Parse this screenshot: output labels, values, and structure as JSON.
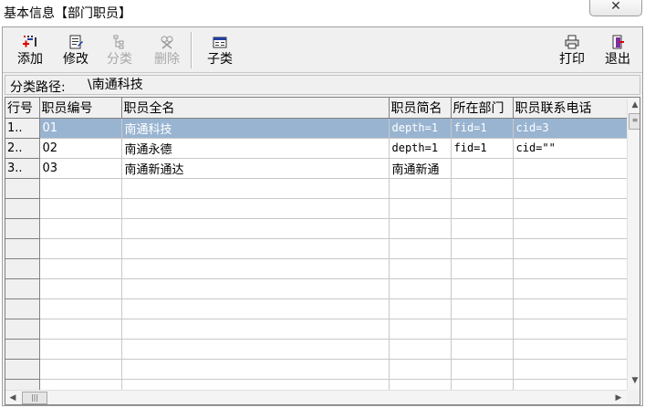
{
  "window": {
    "title": "基本信息【部门职员】",
    "close_glyph": "✕"
  },
  "toolbar": {
    "add": {
      "label": "添加",
      "icon": "add-icon"
    },
    "edit": {
      "label": "修改",
      "icon": "edit-icon"
    },
    "classify": {
      "label": "分类",
      "icon": "classify-icon",
      "disabled": true
    },
    "delete": {
      "label": "删除",
      "icon": "delete-icon",
      "disabled": true
    },
    "subclass": {
      "label": "子类",
      "icon": "subclass-icon"
    },
    "print": {
      "label": "打印",
      "icon": "printer-icon"
    },
    "exit": {
      "label": "退出",
      "icon": "exit-icon"
    }
  },
  "path": {
    "label": "分类路径:",
    "value": "\\南通科技"
  },
  "table": {
    "columns": [
      "行号",
      "职员编号",
      "职员全名",
      "职员简名",
      "所在部门",
      "职员联系电话"
    ],
    "rows": [
      [
        "1..",
        "01",
        "南通科技",
        "depth=1",
        "fid=1",
        "cid=3"
      ],
      [
        "2..",
        "02",
        "南通永德",
        "depth=1",
        "fid=1",
        "cid=\"\""
      ],
      [
        "3..",
        "03",
        "南通新通达",
        "南通新通",
        "",
        ""
      ]
    ],
    "selected_row": 0
  },
  "colors": {
    "selection": "#99b4d1",
    "chrome": "#f0f0f0"
  }
}
